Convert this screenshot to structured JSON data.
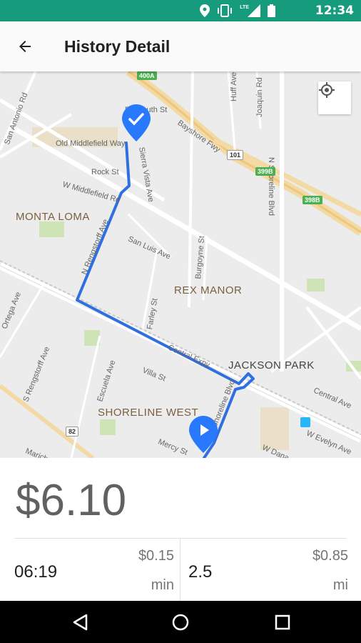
{
  "status_bar": {
    "time": "12:34",
    "icons": [
      "location-icon",
      "vibrate-icon",
      "lte-signal-icon",
      "battery-icon"
    ],
    "lte": "LTE"
  },
  "app_bar": {
    "title": "History Detail"
  },
  "map": {
    "labels": {
      "old_middlefield": "Old Middlefield Way",
      "w_middlefield": "W Middlefield Rd",
      "rock_st": "Rock St",
      "plymouth": "Plymouth St",
      "sierra_vista": "Sierra Vista Ave",
      "bayshore": "Bayshore Fwy",
      "huff": "Huff Ave",
      "joaquin": "Joaquin Rd",
      "n_shoreline": "N Shoreline Blvd",
      "san_antonio": "San Antonio Rd",
      "rengstorff_n": "N Rengstorff Ave",
      "san_luis": "San Luis Ave",
      "burgoyne": "Burgoyne St",
      "farley": "Farley St",
      "central_expy": "Central Expy",
      "s_rengstorff": "S Rengstorff Ave",
      "escuela": "Escuela Ave",
      "villa": "Villa St",
      "mercy": "Mercy St",
      "central_ave": "Central Ave",
      "w_evelyn": "W Evelyn Ave",
      "w_dana": "W Dana",
      "ortega": "Ortega Ave",
      "shoreline_blvd": "Shoreline Blvd",
      "marich": "Marich"
    },
    "neighborhoods": {
      "monta_loma": "MONTA LOMA",
      "rex_manor": "REX MANOR",
      "jackson_park": "JACKSON PARK",
      "shoreline_west": "SHORELINE WEST"
    },
    "shields": {
      "s400a": "400A",
      "s101": "101",
      "s399b": "399B",
      "s398b": "398B",
      "s82": "82"
    },
    "route_color": "#2f6fe0",
    "pin_color": "#2979ff"
  },
  "fare": {
    "total": "$6.10",
    "duration": "06:19",
    "per_min_price": "$0.15",
    "per_min_unit": "min",
    "distance": "2.5",
    "per_mi_price": "$0.85",
    "per_mi_unit": "mi"
  },
  "colors": {
    "status_bar": "#169c7c",
    "fare_text": "#616161"
  }
}
